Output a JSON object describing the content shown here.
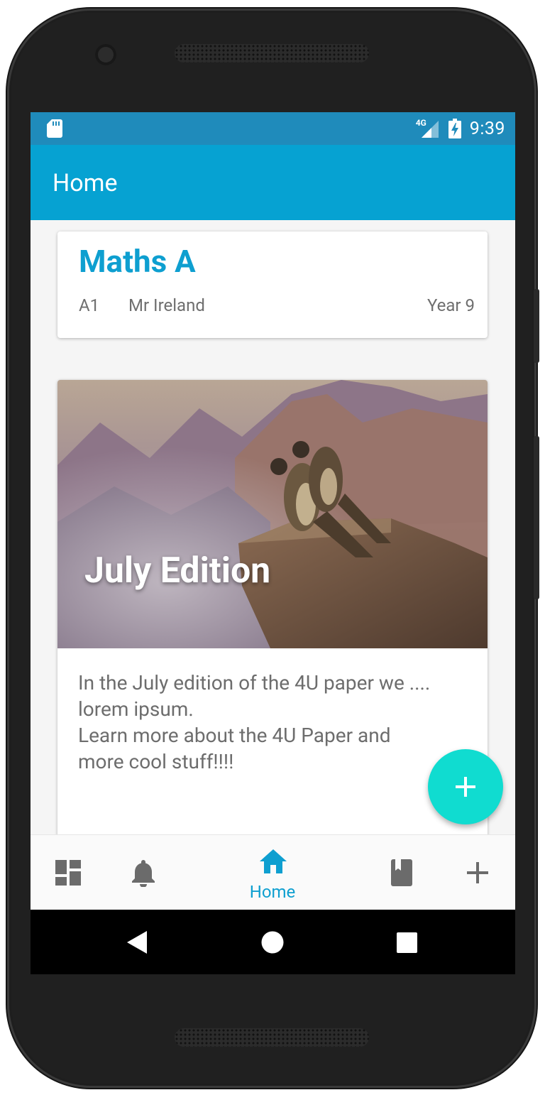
{
  "status_bar": {
    "network": "4G",
    "time": "9:39"
  },
  "app_bar": {
    "title": "Home"
  },
  "class_card": {
    "name": "Maths A",
    "code": "A1",
    "teacher": "Mr Ireland",
    "year": "Year 9"
  },
  "news_card": {
    "title": "July Edition",
    "body_lines": [
      "In the July edition of the 4U paper we ....",
      "lorem ipsum.",
      "Learn more about the 4U Paper and",
      "more cool stuff!!!!"
    ]
  },
  "bottom_nav": {
    "items": [
      {
        "icon": "dashboard-icon",
        "label": ""
      },
      {
        "icon": "bell-icon",
        "label": ""
      },
      {
        "icon": "home-icon",
        "label": "Home",
        "active": true
      },
      {
        "icon": "book-icon",
        "label": ""
      },
      {
        "icon": "plus-icon",
        "label": ""
      }
    ]
  },
  "colors": {
    "status_bar": "#1f8bbb",
    "app_bar": "#06a2d2",
    "accent": "#0e9fd0",
    "fab": "#10dcd0",
    "nav_icon_inactive": "#6b6b6b"
  }
}
